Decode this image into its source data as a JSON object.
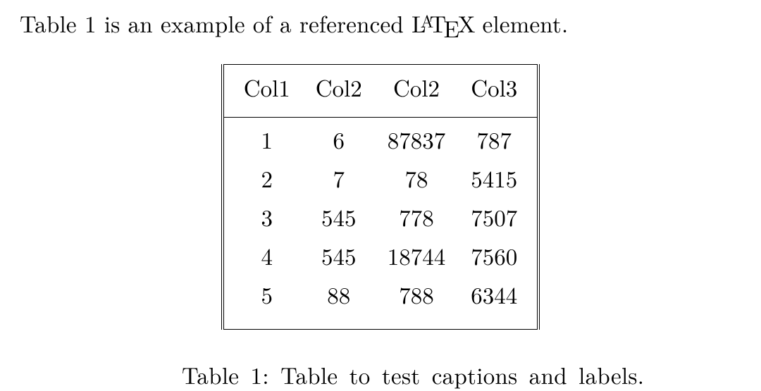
{
  "intro": {
    "prefix": "Table 1 is an example of a referenced ",
    "suffix": " element."
  },
  "latex_parts": {
    "l": "L",
    "a": "A",
    "t": "T",
    "e": "E",
    "x": "X"
  },
  "chart_data": {
    "type": "table",
    "headers": [
      "Col1",
      "Col2",
      "Col2",
      "Col3"
    ],
    "rows": [
      [
        1,
        6,
        87837,
        787
      ],
      [
        2,
        7,
        78,
        5415
      ],
      [
        3,
        545,
        778,
        7507
      ],
      [
        4,
        545,
        18744,
        7560
      ],
      [
        5,
        88,
        788,
        6344
      ]
    ]
  },
  "caption": {
    "label": "Table 1:",
    "text": "Table to test captions and labels."
  }
}
